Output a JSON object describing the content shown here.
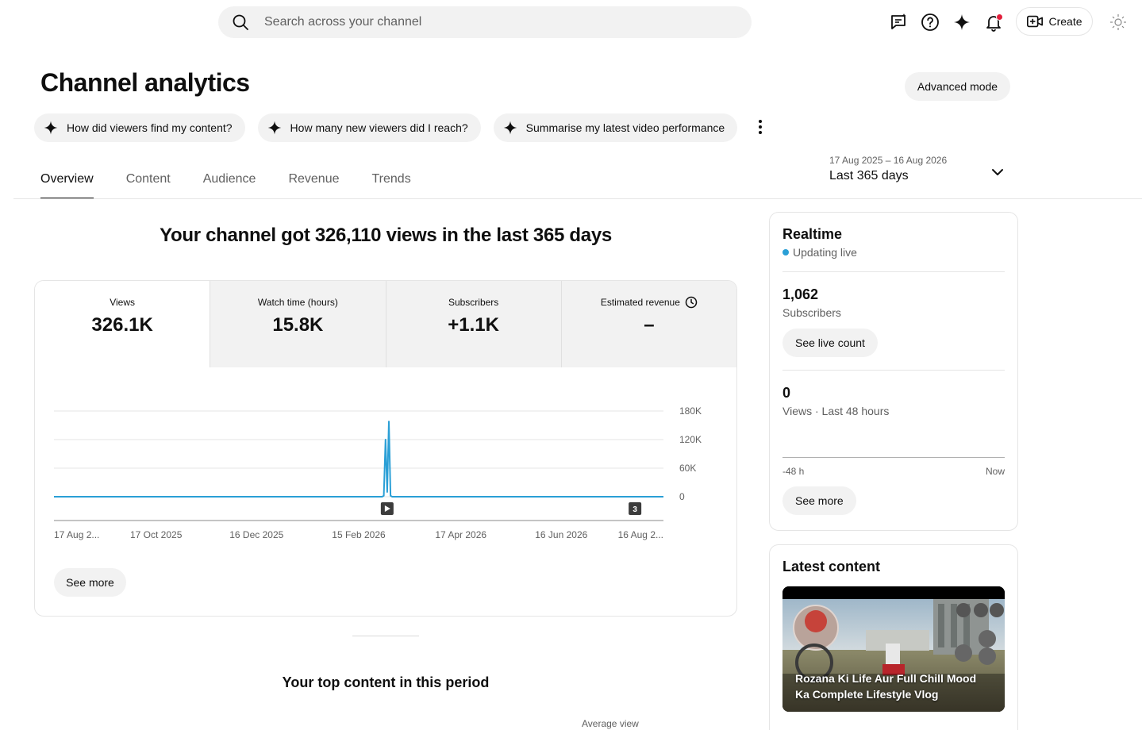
{
  "search": {
    "placeholder": "Search across your channel"
  },
  "topbar": {
    "create_label": "Create"
  },
  "page": {
    "title": "Channel analytics",
    "advanced_mode": "Advanced mode"
  },
  "chips": [
    {
      "label": "How did viewers find my content?"
    },
    {
      "label": "How many new viewers did I reach?"
    },
    {
      "label": "Summarise my latest video performance"
    }
  ],
  "tabs": [
    {
      "label": "Overview",
      "active": true
    },
    {
      "label": "Content"
    },
    {
      "label": "Audience"
    },
    {
      "label": "Revenue"
    },
    {
      "label": "Trends"
    }
  ],
  "date_range": {
    "range": "17 Aug 2025 – 16 Aug 2026",
    "label": "Last 365 days"
  },
  "headline": "Your channel got 326,110 views in the last 365 days",
  "metrics": [
    {
      "label": "Views",
      "value": "326.1K",
      "active": true
    },
    {
      "label": "Watch time (hours)",
      "value": "15.8K"
    },
    {
      "label": "Subscribers",
      "value": "+1.1K"
    },
    {
      "label": "Estimated revenue",
      "value": "–",
      "icon": "clock-icon"
    }
  ],
  "chart_data": {
    "type": "line",
    "series": [
      {
        "values": [
          {
            "x": "2025-08-17",
            "y": 0
          },
          {
            "x": "2026-03-01",
            "y": 0
          },
          {
            "x": "2026-03-02",
            "y": 2000
          },
          {
            "x": "2026-03-03",
            "y": 120000
          },
          {
            "x": "2026-03-04",
            "y": 10000
          },
          {
            "x": "2026-03-05",
            "y": 158000
          },
          {
            "x": "2026-03-06",
            "y": 2000
          },
          {
            "x": "2026-03-07",
            "y": 0
          },
          {
            "x": "2026-08-16",
            "y": 0
          }
        ]
      }
    ],
    "x_ticks": [
      "17 Aug 2...",
      "17 Oct 2025",
      "16 Dec 2025",
      "15 Feb 2026",
      "17 Apr 2026",
      "16 Jun 2026",
      "16 Aug 2..."
    ],
    "y_ticks": [
      "180K",
      "120K",
      "60K",
      "0"
    ],
    "ylim": [
      0,
      180000
    ],
    "grid": true,
    "markers": [
      {
        "x": "2026-03-04",
        "label": "",
        "icon": "play-icon"
      },
      {
        "x": "2026-07-30",
        "label": "3"
      }
    ],
    "color": "#2a9fd6"
  },
  "chart_see_more": "See more",
  "realtime": {
    "title": "Realtime",
    "status": "Updating live",
    "subscribers_value": "1,062",
    "subscribers_label": "Subscribers",
    "see_live_count": "See live count",
    "views_value": "0",
    "views_label": "Views · Last 48 hours",
    "axis_start": "-48 h",
    "axis_end": "Now",
    "see_more": "See more"
  },
  "latest_content": {
    "title": "Latest content",
    "video_title": "Rozana Ki Life Aur Full Chill Mood Ka Complete Lifestyle Vlog"
  },
  "top_content": {
    "title": "Your top content in this period",
    "column_label": "Average view"
  }
}
